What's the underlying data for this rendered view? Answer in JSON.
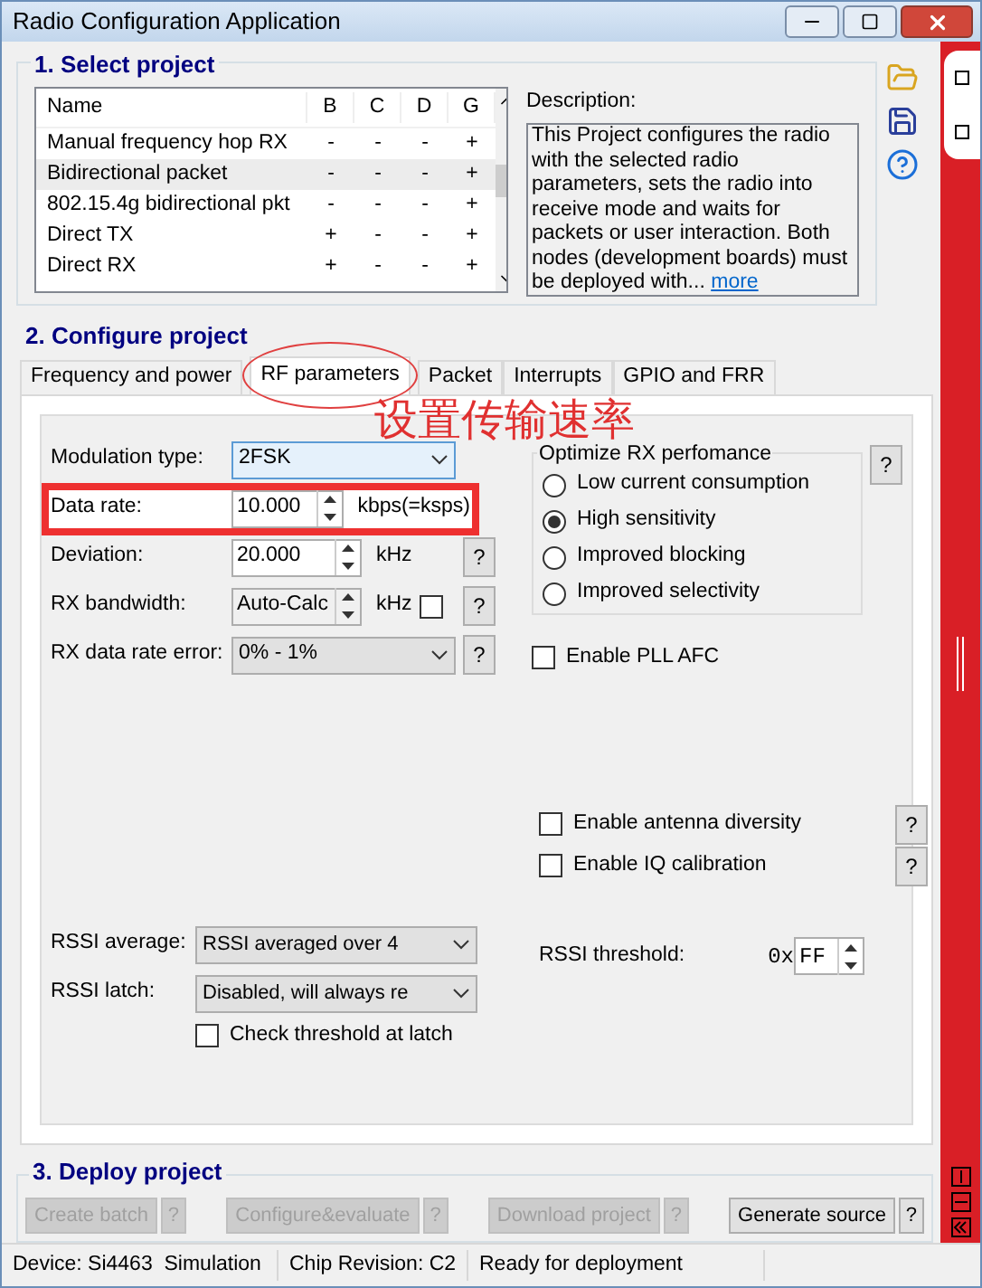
{
  "window": {
    "title": "Radio Configuration Application"
  },
  "select_project": {
    "title": "1. Select project",
    "table": {
      "columns": [
        "Name",
        "B",
        "C",
        "D",
        "G"
      ],
      "rows": [
        {
          "cells": [
            "Manual frequency hop RX",
            "-",
            "-",
            "-",
            "+"
          ],
          "selected": false
        },
        {
          "cells": [
            "Bidirectional packet",
            "-",
            "-",
            "-",
            "+"
          ],
          "selected": true
        },
        {
          "cells": [
            "802.15.4g bidirectional pkt",
            "-",
            "-",
            "-",
            "+"
          ],
          "selected": false
        },
        {
          "cells": [
            "Direct TX",
            "+",
            "-",
            "-",
            "+"
          ],
          "selected": false
        },
        {
          "cells": [
            "Direct RX",
            "+",
            "-",
            "-",
            "+"
          ],
          "selected": false
        }
      ]
    },
    "description": {
      "label": "Description:",
      "text": "This Project configures the radio with the selected radio parameters, sets the radio into receive mode and waits for packets or user interaction. Both nodes (development boards) must be deployed with...",
      "link": "more"
    }
  },
  "configure_project": {
    "title": "2. Configure project",
    "tabs": [
      {
        "label": "Frequency and power",
        "selected": false,
        "circled": false
      },
      {
        "label": "RF parameters",
        "selected": true,
        "circled": true
      },
      {
        "label": "Packet",
        "selected": false,
        "circled": false
      },
      {
        "label": "Interrupts",
        "selected": false,
        "circled": false
      },
      {
        "label": "GPIO and FRR",
        "selected": false,
        "circled": false
      }
    ],
    "annotation": {
      "text": "设置传输速率"
    },
    "fields": [
      {
        "kind": "combo",
        "label": "Modulation type:",
        "value": "2FSK",
        "highlighted": false,
        "focused": true
      },
      {
        "kind": "spin",
        "label": "Data rate:",
        "value": "10.000",
        "unit": "kbps(=ksps)",
        "highlighted": true
      },
      {
        "kind": "spin",
        "label": "Deviation:",
        "value": "20.000",
        "unit": "kHz",
        "help": "?",
        "highlighted": false
      },
      {
        "kind": "spin",
        "label": "RX bandwidth:",
        "value": "Auto-Calc",
        "unit": "kHz",
        "checked": false,
        "help": "?",
        "highlighted": false,
        "disabled": true
      },
      {
        "kind": "combo",
        "label": "RX data rate error:",
        "value": "0% - 1%",
        "help": "?",
        "highlighted": false,
        "focused": false
      }
    ],
    "optimize": {
      "title": "Optimize RX perfomance",
      "help": "?",
      "options": [
        {
          "label": "Low current consumption",
          "selected": false
        },
        {
          "label": "High sensitivity",
          "selected": true
        },
        {
          "label": "Improved blocking",
          "selected": false
        },
        {
          "label": "Improved selectivity",
          "selected": false
        }
      ]
    },
    "pll_afc": {
      "label": "Enable PLL AFC",
      "checked": false
    },
    "options": [
      {
        "label": "Enable antenna diversity",
        "checked": false,
        "help": "?"
      },
      {
        "label": "Enable IQ calibration",
        "checked": false,
        "help": "?"
      }
    ],
    "rssi": [
      {
        "label": "RSSI average:",
        "value": "RSSI averaged over 4"
      },
      {
        "label": "RSSI latch:",
        "value": "Disabled, will always re"
      }
    ],
    "check_threshold": {
      "label": "Check threshold at latch",
      "checked": false
    },
    "rssi_threshold": {
      "label": "RSSI threshold:",
      "prefix": "0x",
      "value": "FF"
    }
  },
  "deploy_project": {
    "title": "3. Deploy project",
    "buttons": [
      {
        "label": "Create batch",
        "disabled": true,
        "help": "?"
      },
      {
        "label": "Configure&evaluate",
        "disabled": true,
        "help": "?"
      },
      {
        "label": "Download project",
        "disabled": true,
        "help": "?"
      },
      {
        "label": "Generate source",
        "disabled": false,
        "help": "?"
      }
    ]
  },
  "status_bar": [
    "Device: Si4463  Simulation",
    "Chip Revision: C2",
    "Ready for deployment"
  ]
}
